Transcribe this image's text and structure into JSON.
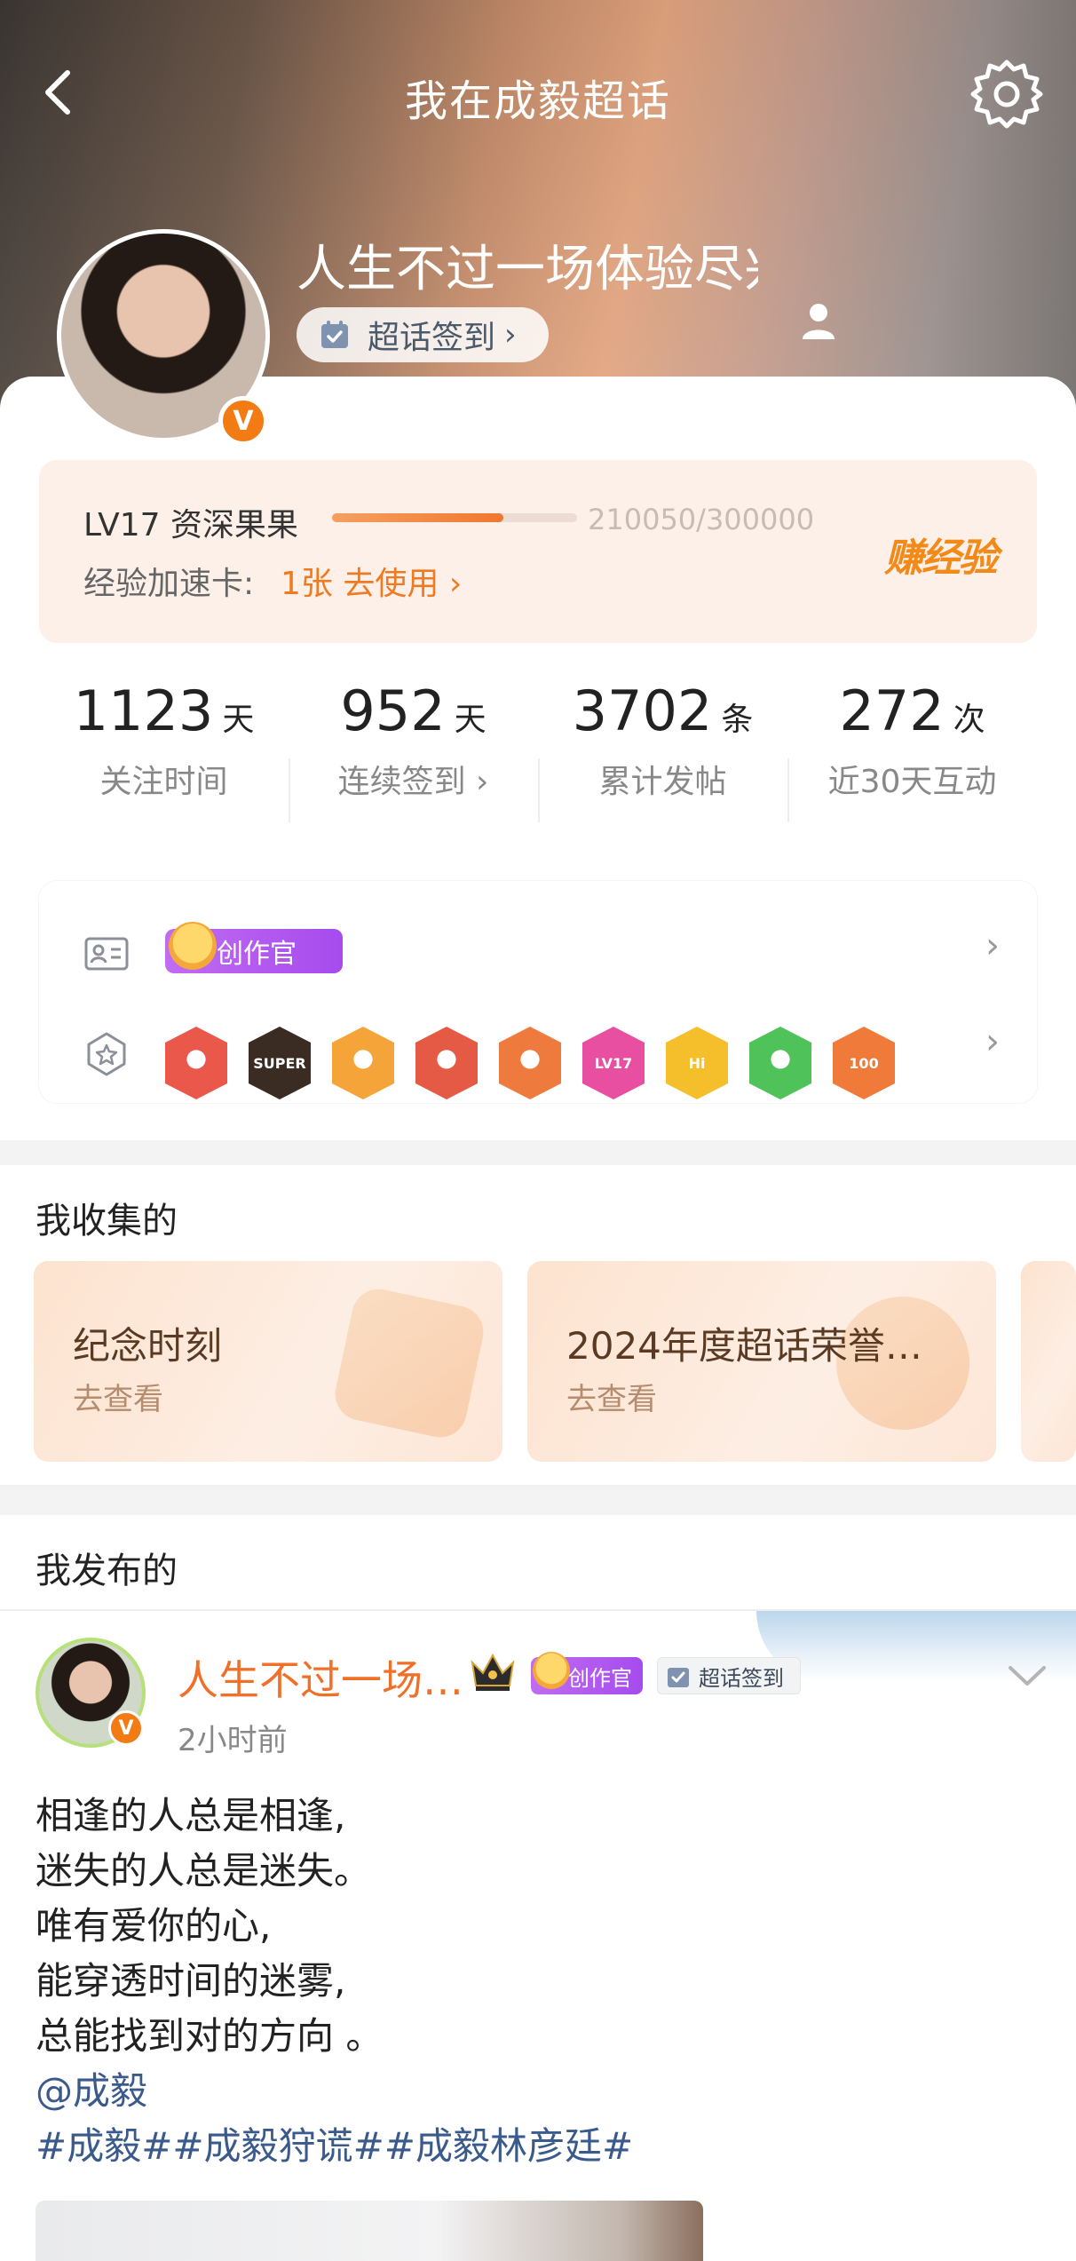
{
  "header": {
    "title": "我在成毅超话"
  },
  "profile": {
    "username": "人生不过一场体验尽兴",
    "verified_mark": "V",
    "checkin_label": "超话签到"
  },
  "level": {
    "title": "LV17 资深果果",
    "progress_text": "210050/300000",
    "progress_fraction": 0.7002,
    "speed_card_label": "经验加速卡:",
    "speed_card_value": "1张 去使用",
    "earn_label": "赚经验"
  },
  "stats": [
    {
      "value": "1123",
      "unit": "天",
      "label": "关注时间"
    },
    {
      "value": "952",
      "unit": "天",
      "label": "连续签到 ›"
    },
    {
      "value": "3702",
      "unit": "条",
      "label": "累计发帖"
    },
    {
      "value": "272",
      "unit": "次",
      "label": "近30天互动"
    }
  ],
  "honors": {
    "creator_tag": "创作官",
    "badges": [
      {
        "icon": "fox-badge",
        "color": "#e9584a",
        "text": ""
      },
      {
        "icon": "super-crown-badge",
        "color": "#3a2c22",
        "text": "SUPER"
      },
      {
        "icon": "crown-badge",
        "color": "#f5a43a",
        "text": ""
      },
      {
        "icon": "lion-badge",
        "color": "#e55a44",
        "text": ""
      },
      {
        "icon": "fox-fire-badge",
        "color": "#ef7a3e",
        "text": ""
      },
      {
        "icon": "lv17-badge",
        "color": "#e94fa0",
        "text": "LV17"
      },
      {
        "icon": "hi-badge",
        "color": "#f5bf2c",
        "text": "Hi"
      },
      {
        "icon": "hand-badge",
        "color": "#4fc25a",
        "text": ""
      },
      {
        "icon": "100-days-badge",
        "color": "#f07a3a",
        "text": "100"
      }
    ]
  },
  "collected": {
    "title": "我收集的",
    "cards": [
      {
        "title": "纪念时刻",
        "subtitle": "去查看"
      },
      {
        "title": "2024年度超话荣誉…",
        "subtitle": "去查看"
      }
    ]
  },
  "posted": {
    "title": "我发布的",
    "post": {
      "user": "人生不过一场…",
      "creator_tag": "创作官",
      "checkin_tag": "超话签到",
      "time": "2小时前",
      "lines": [
        "相逢的人总是相逢,",
        "迷失的人总是迷失。",
        "唯有爱你的心,",
        "能穿透时间的迷雾,",
        "总能找到对的方向 。"
      ],
      "mention": "@成毅",
      "tags": "#成毅##成毅狩谎##成毅林彦廷#"
    }
  },
  "colors": {
    "accent": "#f07a20",
    "link": "#3b5a8c",
    "creator_purple": "#b35cf0",
    "verified_orange": "#f27b13"
  }
}
